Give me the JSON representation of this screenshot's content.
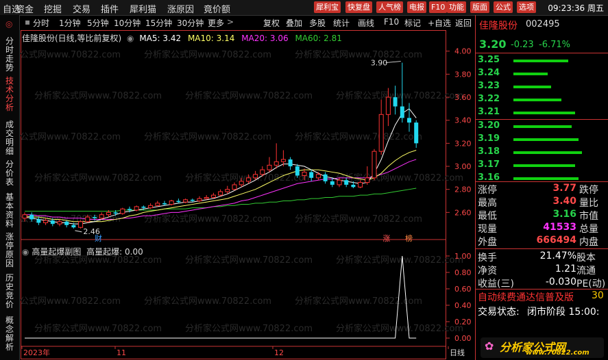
{
  "menubar": {
    "items": [
      "自选",
      "资金",
      "挖掘",
      "交易",
      "插件",
      "犀利猫",
      "涨原因",
      "竟价额"
    ],
    "tools": [
      "犀利宝",
      "快复盘",
      "人气榜",
      "电报",
      "F10",
      "功能",
      "版面",
      "公式",
      "选项"
    ],
    "clock": "09:23:36 周五"
  },
  "left_tabs": [
    "分时走势",
    "技术分析",
    "成交明细",
    "分价表",
    "基本资料",
    "涨停原因",
    "历史竞价",
    "概念解析"
  ],
  "toolbar": {
    "periods": [
      "分时",
      "1分钟",
      "5分钟",
      "10分钟",
      "15分钟",
      "30分钟",
      "更多"
    ],
    "actions": [
      "复权",
      "叠加",
      "多股",
      "统计",
      "画线",
      "F10",
      "标记",
      "+自选",
      "返回"
    ]
  },
  "chart_header": {
    "name": "佳隆股份(日线,等比前复权)",
    "ma5": "MA5: 3.42",
    "ma10": "MA10: 3.14",
    "ma20": "MA20: 3.06",
    "ma60": "MA60: 2.81"
  },
  "sub_header": {
    "name": "高量起爆副图",
    "value": "高量起爆: 0.00"
  },
  "colors": {
    "up": "#ff3333",
    "down": "#22d8ee",
    "ma5": "#ffffff",
    "ma10": "#ffff66",
    "ma20": "#ff33ff",
    "ma60": "#33cc33"
  },
  "chart_data": {
    "type": "candlestick",
    "y_axis_ticks": [
      "4.00",
      "3.80",
      "3.60",
      "3.40",
      "3.20",
      "3.00",
      "2.80",
      "2.60"
    ],
    "y_range": [
      2.46,
      4.0
    ],
    "x_axis_labels": [
      "2023年",
      "11",
      "12",
      "日线"
    ],
    "annotations": {
      "high": "3.90",
      "low": "2.46",
      "markers": [
        "财",
        "涨",
        "榜"
      ]
    },
    "candles": [
      [
        2.55,
        2.58,
        2.52,
        2.6
      ],
      [
        2.58,
        2.54,
        2.52,
        2.6
      ],
      [
        2.54,
        2.51,
        2.49,
        2.56
      ],
      [
        2.51,
        2.53,
        2.49,
        2.55
      ],
      [
        2.53,
        2.5,
        2.48,
        2.55
      ],
      [
        2.5,
        2.52,
        2.48,
        2.54
      ],
      [
        2.52,
        2.49,
        2.47,
        2.53
      ],
      [
        2.49,
        2.47,
        2.46,
        2.51
      ],
      [
        2.47,
        2.52,
        2.46,
        2.53
      ],
      [
        2.52,
        2.56,
        2.51,
        2.58
      ],
      [
        2.56,
        2.55,
        2.53,
        2.58
      ],
      [
        2.55,
        2.58,
        2.54,
        2.6
      ],
      [
        2.58,
        2.6,
        2.56,
        2.62
      ],
      [
        2.6,
        2.59,
        2.57,
        2.62
      ],
      [
        2.59,
        2.63,
        2.58,
        2.64
      ],
      [
        2.63,
        2.62,
        2.6,
        2.65
      ],
      [
        2.62,
        2.65,
        2.61,
        2.66
      ],
      [
        2.65,
        2.64,
        2.62,
        2.66
      ],
      [
        2.64,
        2.66,
        2.63,
        2.68
      ],
      [
        2.66,
        2.68,
        2.65,
        2.7
      ],
      [
        2.68,
        2.67,
        2.66,
        2.7
      ],
      [
        2.67,
        2.7,
        2.66,
        2.71
      ],
      [
        2.7,
        2.69,
        2.68,
        2.72
      ],
      [
        2.69,
        2.71,
        2.68,
        2.72
      ],
      [
        2.71,
        2.7,
        2.69,
        2.72
      ],
      [
        2.7,
        2.72,
        2.69,
        2.74
      ],
      [
        2.72,
        2.73,
        2.71,
        2.75
      ],
      [
        2.73,
        2.75,
        2.72,
        2.77
      ],
      [
        2.75,
        2.78,
        2.74,
        2.8
      ],
      [
        2.78,
        2.8,
        2.76,
        2.83
      ],
      [
        2.8,
        2.84,
        2.79,
        2.86
      ],
      [
        2.84,
        2.87,
        2.82,
        2.9
      ],
      [
        2.87,
        2.9,
        2.85,
        2.93
      ],
      [
        2.9,
        2.93,
        2.88,
        2.96
      ],
      [
        2.93,
        2.97,
        2.91,
        3.0
      ],
      [
        2.97,
        3.01,
        2.95,
        3.08
      ],
      [
        3.01,
        3.04,
        2.98,
        3.2
      ],
      [
        3.04,
        3.06,
        3.0,
        3.14
      ],
      [
        3.06,
        3.0,
        2.97,
        3.08
      ],
      [
        3.0,
        2.92,
        2.9,
        3.02
      ],
      [
        2.92,
        2.95,
        2.88,
        2.98
      ],
      [
        2.95,
        2.9,
        2.87,
        2.97
      ],
      [
        2.9,
        2.93,
        2.88,
        2.95
      ],
      [
        2.93,
        2.87,
        2.85,
        2.95
      ],
      [
        2.87,
        2.84,
        2.82,
        2.9
      ],
      [
        2.84,
        2.88,
        2.82,
        2.9
      ],
      [
        2.88,
        2.84,
        2.82,
        2.9
      ],
      [
        2.84,
        2.82,
        2.81,
        2.87
      ],
      [
        2.82,
        2.86,
        2.81,
        2.88
      ],
      [
        2.86,
        2.9,
        2.84,
        3.0
      ],
      [
        2.9,
        3.13,
        2.88,
        3.15
      ],
      [
        3.13,
        3.45,
        3.1,
        3.58
      ],
      [
        3.45,
        3.6,
        3.35,
        3.68
      ],
      [
        3.6,
        3.52,
        3.45,
        3.7
      ],
      [
        3.52,
        3.42,
        3.38,
        3.9
      ],
      [
        3.42,
        3.38,
        3.3,
        3.55
      ],
      [
        3.38,
        3.2,
        3.16,
        3.4
      ]
    ],
    "ma5": [
      2.56,
      2.55,
      2.54,
      2.53,
      2.52,
      2.51,
      2.51,
      2.5,
      2.5,
      2.51,
      2.52,
      2.54,
      2.56,
      2.58,
      2.6,
      2.61,
      2.62,
      2.63,
      2.64,
      2.65,
      2.66,
      2.67,
      2.68,
      2.69,
      2.69,
      2.7,
      2.71,
      2.72,
      2.74,
      2.76,
      2.79,
      2.82,
      2.85,
      2.88,
      2.92,
      2.95,
      2.99,
      3.02,
      3.02,
      3.01,
      3.0,
      2.97,
      2.94,
      2.91,
      2.9,
      2.88,
      2.87,
      2.86,
      2.85,
      2.86,
      2.94,
      3.06,
      3.22,
      3.36,
      3.46,
      3.5,
      3.42
    ],
    "ma10": [
      2.57,
      2.56,
      2.56,
      2.55,
      2.54,
      2.54,
      2.53,
      2.52,
      2.52,
      2.52,
      2.52,
      2.52,
      2.53,
      2.54,
      2.55,
      2.57,
      2.58,
      2.6,
      2.61,
      2.62,
      2.63,
      2.64,
      2.65,
      2.66,
      2.67,
      2.68,
      2.69,
      2.7,
      2.71,
      2.72,
      2.74,
      2.76,
      2.78,
      2.8,
      2.83,
      2.86,
      2.89,
      2.92,
      2.94,
      2.96,
      2.97,
      2.97,
      2.97,
      2.96,
      2.95,
      2.94,
      2.92,
      2.9,
      2.89,
      2.88,
      2.9,
      2.94,
      3.0,
      3.05,
      3.09,
      3.12,
      3.14
    ],
    "ma20": [
      2.58,
      2.58,
      2.57,
      2.57,
      2.56,
      2.56,
      2.55,
      2.55,
      2.55,
      2.54,
      2.54,
      2.54,
      2.54,
      2.54,
      2.55,
      2.55,
      2.56,
      2.57,
      2.57,
      2.58,
      2.59,
      2.6,
      2.6,
      2.61,
      2.62,
      2.63,
      2.64,
      2.65,
      2.66,
      2.67,
      2.68,
      2.7,
      2.71,
      2.73,
      2.75,
      2.77,
      2.79,
      2.81,
      2.83,
      2.85,
      2.86,
      2.87,
      2.88,
      2.89,
      2.89,
      2.9,
      2.9,
      2.9,
      2.9,
      2.9,
      2.91,
      2.93,
      2.95,
      2.98,
      3.01,
      3.04,
      3.06
    ],
    "ma60": [
      2.61,
      2.61,
      2.61,
      2.61,
      2.61,
      2.61,
      2.61,
      2.61,
      2.61,
      2.61,
      2.61,
      2.61,
      2.61,
      2.61,
      2.62,
      2.62,
      2.62,
      2.62,
      2.62,
      2.62,
      2.63,
      2.63,
      2.63,
      2.63,
      2.64,
      2.64,
      2.64,
      2.65,
      2.65,
      2.66,
      2.66,
      2.67,
      2.67,
      2.68,
      2.68,
      2.69,
      2.69,
      2.7,
      2.7,
      2.71,
      2.71,
      2.72,
      2.72,
      2.73,
      2.73,
      2.74,
      2.74,
      2.74,
      2.75,
      2.75,
      2.76,
      2.76,
      2.77,
      2.78,
      2.79,
      2.8,
      2.81
    ],
    "sub_y_ticks": [
      "1.00",
      "0.80",
      "0.60",
      "0.40",
      "0.20",
      "0.00"
    ],
    "sub_values": [
      0,
      0,
      0,
      0,
      0,
      0,
      0,
      0,
      0,
      0,
      0,
      0,
      0,
      0,
      0,
      0,
      0,
      0,
      0,
      0,
      0,
      0,
      0,
      0,
      0,
      0,
      0,
      0,
      0,
      0,
      0,
      0,
      0,
      0,
      0,
      0,
      0,
      0,
      0,
      0,
      0,
      0,
      0,
      0,
      0,
      0,
      0,
      0,
      0,
      0,
      0,
      0,
      0,
      0,
      1,
      0,
      0
    ]
  },
  "quote": {
    "name": "佳隆股份",
    "code": "002495",
    "price": "3.20",
    "change": "-0.23",
    "pct": "-6.71%",
    "asks": [
      [
        "3.25",
        0.8
      ],
      [
        "3.24",
        0.5
      ],
      [
        "3.23",
        0.55
      ],
      [
        "3.22",
        0.7
      ],
      [
        "3.21",
        0.9
      ]
    ],
    "bids": [
      [
        "3.20",
        0.85
      ],
      [
        "3.19",
        0.95
      ],
      [
        "3.18",
        1.0
      ],
      [
        "3.17",
        0.9
      ],
      [
        "3.16",
        0.95
      ]
    ],
    "stats": [
      [
        "涨停",
        "3.77",
        "跌停",
        ""
      ],
      [
        "最高",
        "3.40",
        "量比",
        ""
      ],
      [
        "最低",
        "3.16",
        "市值",
        ""
      ],
      [
        "现量",
        "41533",
        "总量",
        ""
      ],
      [
        "外盘",
        "666494",
        "内盘",
        ""
      ]
    ],
    "stats2": [
      [
        "换手",
        "21.47%",
        "股本"
      ],
      [
        "净资",
        "1.21",
        "流通"
      ],
      [
        "收益(三)",
        "-0.030",
        "PE(动)"
      ]
    ],
    "ad": "自动续费通达信普及版",
    "ad_tail": "30",
    "status_label": "交易状态:",
    "status": "闭市阶段 15:00:"
  },
  "watermark": {
    "text": "分析家公式网www.70822.com",
    "logo": "分析家公式网",
    "logo_url": "www.70822.com"
  }
}
